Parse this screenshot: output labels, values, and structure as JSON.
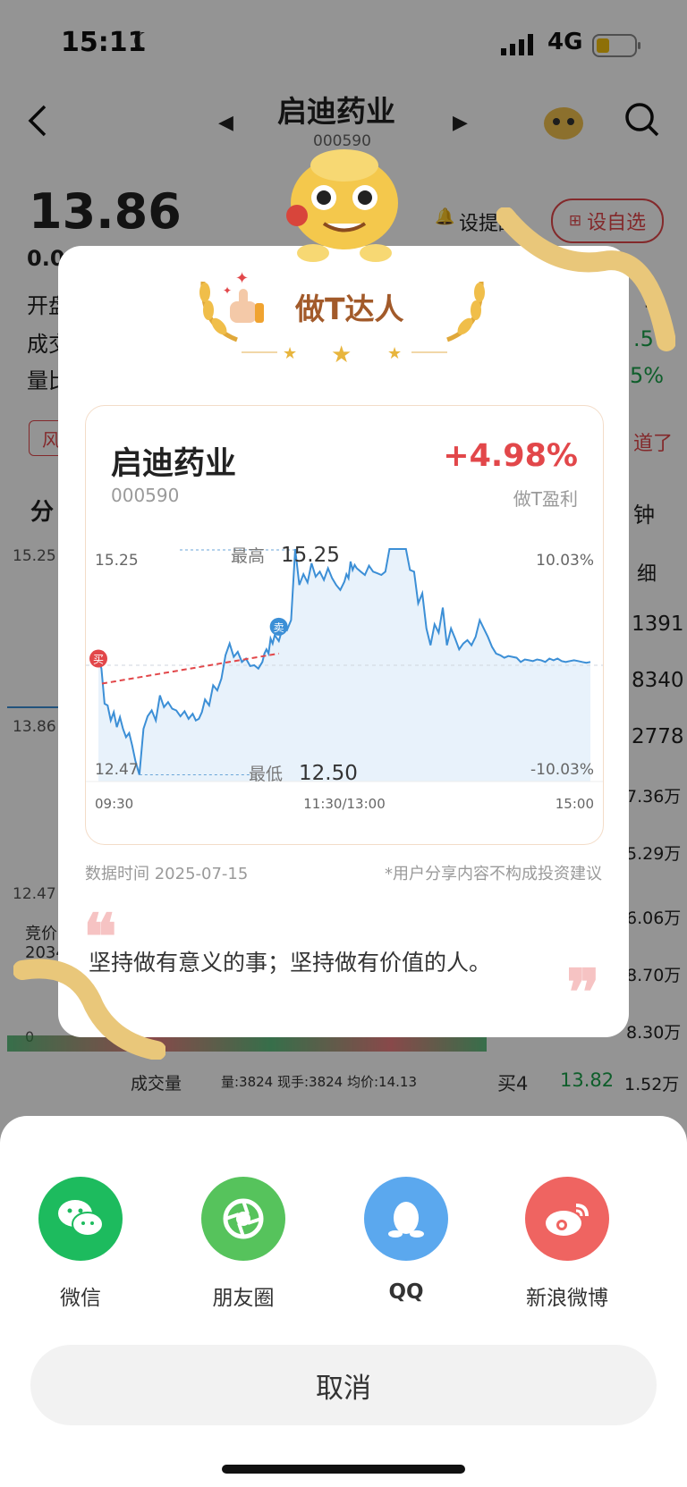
{
  "status_bar": {
    "time": "15:11",
    "network": "4G"
  },
  "header": {
    "title": "启迪药业",
    "code": "000590"
  },
  "quote": {
    "price": "13.86",
    "change_partial": "0.0",
    "remind": "设提醒",
    "add_watch": "设自选"
  },
  "bg_left_labels": [
    "开盘",
    "成交",
    "量比"
  ],
  "bg_right_values": [
    "5",
    ".5",
    "5%"
  ],
  "bg_misc": {
    "risk_tag": "风",
    "notice": "道了",
    "tab_fen": "分",
    "tab_min": "钟",
    "detail": "细"
  },
  "bg_chart": {
    "high": "15.25",
    "mid": "13.86",
    "low": "12.47",
    "auction": "竞价",
    "auction_val": "2034",
    "vol_zero": "0"
  },
  "bg_orderbook": [
    "1391",
    "8340",
    "2778",
    "7.36万",
    "5.29万",
    "6.06万",
    "8.70万",
    "8.30万"
  ],
  "bg_bottom": {
    "volume_label": "成交量",
    "volume_info": "量:3824  现手:3824  均价:14.13",
    "ask4_label": "买4",
    "ask4_price": "13.82",
    "ask4_vol": "1.52万"
  },
  "share_card": {
    "badge_title": "做T达人",
    "stock_name": "启迪药业",
    "stock_code": "000590",
    "profit_pct": "+4.98%",
    "profit_label": "做T盈利",
    "date_text": "数据时间 2025-07-15",
    "disclaimer": "*用户分享内容不构成投资建议",
    "quote_text": "坚持做有意义的事；坚持做有价值的人。"
  },
  "chart_data": {
    "type": "line",
    "title": "",
    "x_ticks": [
      "09:30",
      "11:30/13:00",
      "15:00"
    ],
    "y_left_ticks": [
      "15.25",
      "12.47"
    ],
    "y_right_ticks": [
      "10.03%",
      "-10.03%"
    ],
    "high_label": "最高",
    "high_value": "15.25",
    "low_label": "最低",
    "low_value": "12.50",
    "ylim": [
      12.47,
      15.25
    ],
    "prev_close": 13.86,
    "x": [
      0,
      3,
      6,
      9,
      12,
      15,
      18,
      21,
      24,
      27,
      30,
      33,
      36,
      40,
      44,
      48,
      52,
      56,
      60,
      64,
      68,
      72,
      76,
      80,
      84,
      88,
      92,
      95,
      98,
      101,
      104,
      108,
      112,
      116,
      120,
      124,
      128,
      132,
      136,
      140,
      144,
      148,
      152,
      156,
      160,
      162,
      164,
      166,
      168,
      170,
      172,
      176,
      180,
      184,
      188,
      192,
      196,
      200,
      204,
      208,
      212,
      216,
      220,
      224,
      228,
      232,
      236,
      240,
      242,
      244,
      246,
      248,
      250,
      252,
      256,
      260,
      264,
      268,
      272,
      276,
      280,
      284,
      288,
      292,
      296,
      300,
      304,
      308,
      312,
      316,
      320,
      324,
      328,
      332,
      336,
      340,
      344,
      348,
      352,
      356,
      360,
      364,
      368,
      372,
      376,
      380,
      384,
      388,
      392,
      396,
      400,
      404,
      408,
      412,
      416,
      420,
      424,
      428,
      432,
      436,
      440,
      444,
      448,
      452,
      456,
      460,
      464,
      468,
      472,
      476,
      480
    ],
    "y": [
      13.94,
      13.82,
      13.4,
      13.38,
      13.2,
      13.3,
      13.12,
      13.24,
      13.1,
      13.0,
      13.05,
      12.9,
      12.72,
      12.55,
      13.1,
      13.25,
      13.32,
      13.2,
      13.5,
      13.36,
      13.42,
      13.34,
      13.32,
      13.25,
      13.31,
      13.22,
      13.28,
      13.2,
      13.22,
      13.3,
      13.45,
      13.38,
      13.62,
      13.56,
      13.7,
      13.98,
      14.12,
      13.96,
      14.02,
      13.9,
      13.94,
      13.85,
      13.86,
      13.82,
      13.9,
      14.0,
      14.05,
      14.0,
      14.18,
      14.12,
      14.22,
      14.15,
      14.32,
      14.28,
      14.4,
      15.25,
      14.82,
      14.95,
      14.85,
      15.08,
      14.92,
      14.98,
      14.88,
      15.02,
      14.9,
      14.82,
      14.76,
      14.86,
      14.95,
      14.9,
      15.1,
      15.0,
      15.06,
      15.02,
      14.98,
      14.94,
      15.05,
      14.98,
      14.96,
      14.94,
      14.98,
      15.25,
      15.25,
      15.25,
      15.25,
      15.25,
      15.0,
      14.98,
      14.6,
      14.72,
      14.3,
      14.1,
      14.35,
      14.25,
      14.55,
      14.1,
      14.3,
      14.18,
      14.05,
      14.12,
      14.16,
      14.1,
      14.2,
      14.4,
      14.3,
      14.2,
      14.08,
      14.0,
      13.98,
      13.95,
      13.97,
      13.96,
      13.95,
      13.9,
      13.93,
      13.92,
      13.91,
      13.93,
      13.92,
      13.9,
      13.94,
      13.92,
      13.94,
      13.91,
      13.9,
      13.91,
      13.92,
      13.91,
      13.9,
      13.89,
      13.9
    ],
    "buy_label": "买",
    "sell_label": "卖",
    "colors": {
      "line": "#3c8fd6",
      "fill": "#e8f2fb",
      "marker_red": "#e2474a",
      "marker_blue": "#3c8fd6"
    }
  },
  "share_options": [
    {
      "label": "微信",
      "icon": "wechat-icon",
      "color": "#1dbb5e"
    },
    {
      "label": "朋友圈",
      "icon": "moments-icon",
      "color": "#56c35c"
    },
    {
      "label": "QQ",
      "icon": "qq-icon",
      "color": "#5ba8ee"
    },
    {
      "label": "新浪微博",
      "icon": "weibo-icon",
      "color": "#ef6461"
    }
  ],
  "cancel_label": "取消"
}
